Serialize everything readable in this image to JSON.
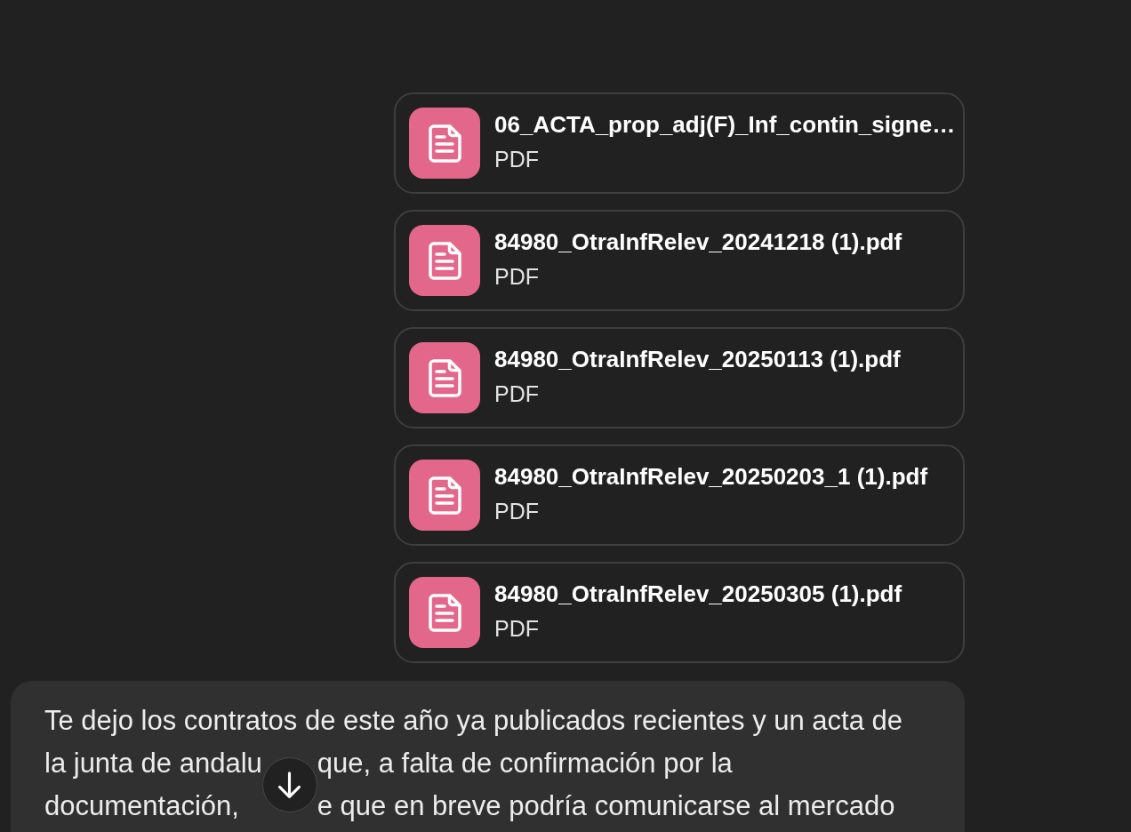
{
  "attachments": [
    {
      "name": "06_ACTA_prop_adj(F)_Inf_contin_signe…",
      "type": "PDF"
    },
    {
      "name": "84980_OtraInfRelev_20241218 (1).pdf",
      "type": "PDF"
    },
    {
      "name": "84980_OtraInfRelev_20250113 (1).pdf",
      "type": "PDF"
    },
    {
      "name": "84980_OtraInfRelev_20250203_1 (1).pdf",
      "type": "PDF"
    },
    {
      "name": "84980_OtraInfRelev_20250305 (1).pdf",
      "type": "PDF"
    }
  ],
  "message": {
    "lines": [
      [
        "Te dejo los contratos de este año ya publicados recientes y un acta de"
      ],
      [
        "la junta de andalu",
        "que, a falta de confirmación por la"
      ],
      [
        "documentación,",
        "e que en breve podría comunicarse al mercado"
      ]
    ]
  }
}
